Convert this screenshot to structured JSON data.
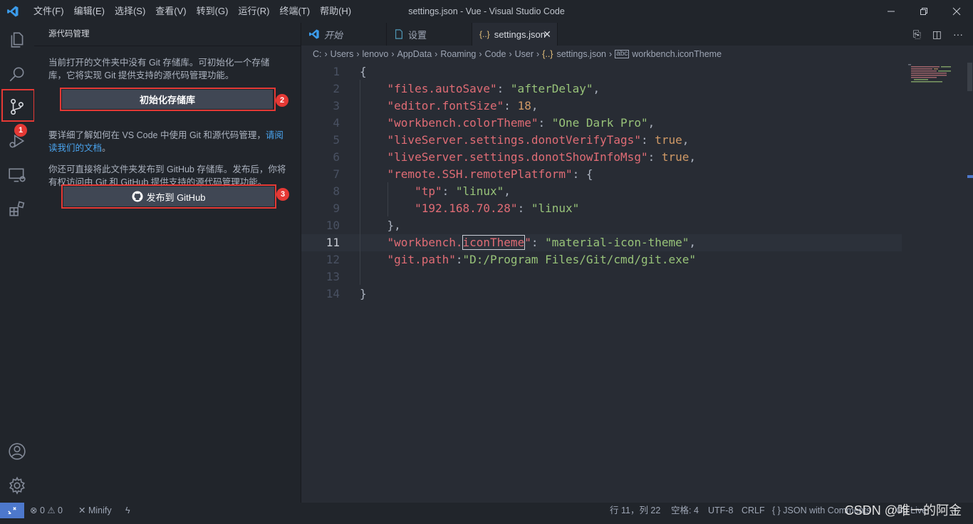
{
  "window": {
    "title": "settings.json - Vue - Visual Studio Code",
    "menu": [
      "文件(F)",
      "编辑(E)",
      "选择(S)",
      "查看(V)",
      "转到(G)",
      "运行(R)",
      "终端(T)",
      "帮助(H)"
    ]
  },
  "activity": {
    "badges": [
      "1",
      "2",
      "3"
    ]
  },
  "sidebar": {
    "header": "源代码管理",
    "intro": "当前打开的文件夹中没有 Git 存储库。可初始化一个存储库，它将实现 Git 提供支持的源代码管理功能。",
    "init_button": "初始化存储库",
    "learn_text": "要详细了解如何在 VS Code 中使用 Git 和源代码管理，",
    "learn_link": "请阅读我们的文档",
    "learn_end": "。",
    "publish_text": "你还可直接将此文件夹发布到 GitHub 存储库。发布后，你将有权访问由 Git 和 GitHub 提供支持的源代码管理功能。",
    "publish_button": "发布到 GitHub"
  },
  "tabs": [
    {
      "label": "开始",
      "icon": "vscode-icon"
    },
    {
      "label": "设置",
      "icon": "file-icon"
    },
    {
      "label": "settings.json",
      "icon": "json-icon",
      "glyph": "{..}",
      "active": true
    }
  ],
  "breadcrumb": [
    "C:",
    "Users",
    "lenovo",
    "AppData",
    "Roaming",
    "Code",
    "User",
    "settings.json",
    "workbench.iconTheme"
  ],
  "editor": {
    "current_line": 11,
    "lines": [
      {
        "n": "1",
        "tokens": [
          [
            "p",
            "{"
          ]
        ]
      },
      {
        "n": "2",
        "tokens": [
          [
            "p",
            "    "
          ],
          [
            "k",
            "\"files.autoSave\""
          ],
          [
            "p",
            ": "
          ],
          [
            "s",
            "\"afterDelay\""
          ],
          [
            "p",
            ","
          ]
        ]
      },
      {
        "n": "3",
        "tokens": [
          [
            "p",
            "    "
          ],
          [
            "k",
            "\"editor.fontSize\""
          ],
          [
            "p",
            ": "
          ],
          [
            "n",
            "18"
          ],
          [
            "p",
            ","
          ]
        ]
      },
      {
        "n": "4",
        "tokens": [
          [
            "p",
            "    "
          ],
          [
            "k",
            "\"workbench.colorTheme\""
          ],
          [
            "p",
            ": "
          ],
          [
            "s",
            "\"One Dark Pro\""
          ],
          [
            "p",
            ","
          ]
        ]
      },
      {
        "n": "5",
        "tokens": [
          [
            "p",
            "    "
          ],
          [
            "k",
            "\"liveServer.settings.donotVerifyTags\""
          ],
          [
            "p",
            ": "
          ],
          [
            "n",
            "true"
          ],
          [
            "p",
            ","
          ]
        ]
      },
      {
        "n": "6",
        "tokens": [
          [
            "p",
            "    "
          ],
          [
            "k",
            "\"liveServer.settings.donotShowInfoMsg\""
          ],
          [
            "p",
            ": "
          ],
          [
            "n",
            "true"
          ],
          [
            "p",
            ","
          ]
        ]
      },
      {
        "n": "7",
        "tokens": [
          [
            "p",
            "    "
          ],
          [
            "k",
            "\"remote.SSH.remotePlatform\""
          ],
          [
            "p",
            ": {"
          ]
        ]
      },
      {
        "n": "8",
        "tokens": [
          [
            "p",
            "        "
          ],
          [
            "k",
            "\"tp\""
          ],
          [
            "p",
            ": "
          ],
          [
            "s",
            "\"linux\""
          ],
          [
            "p",
            ","
          ]
        ]
      },
      {
        "n": "9",
        "tokens": [
          [
            "p",
            "        "
          ],
          [
            "k",
            "\"192.168.70.28\""
          ],
          [
            "p",
            ": "
          ],
          [
            "s",
            "\"linux\""
          ]
        ]
      },
      {
        "n": "10",
        "tokens": [
          [
            "p",
            "    },"
          ]
        ]
      },
      {
        "n": "11",
        "tokens": [
          [
            "p",
            "    "
          ],
          [
            "k",
            "\"workbench."
          ],
          [
            "k hl",
            "iconTheme"
          ],
          [
            "k",
            "\""
          ],
          [
            "p",
            ": "
          ],
          [
            "s",
            "\"material-icon-theme\""
          ],
          [
            "p",
            ","
          ]
        ]
      },
      {
        "n": "12",
        "tokens": [
          [
            "p",
            "    "
          ],
          [
            "k",
            "\"git.path\""
          ],
          [
            "p",
            ":"
          ],
          [
            "s",
            "\"D:/Program Files/Git/cmd/git.exe\""
          ]
        ]
      },
      {
        "n": "13",
        "tokens": []
      },
      {
        "n": "14",
        "tokens": [
          [
            "p",
            "}"
          ]
        ]
      }
    ]
  },
  "status": {
    "remote": "⨯",
    "problems": "⊗ 0 ⚠ 0",
    "minify": "✕ Minify",
    "position": "行 11，列 22",
    "spaces": "空格: 4",
    "encoding": "UTF-8",
    "eol": "CRLF",
    "language": "{ } JSON with Comments",
    "golive": "Go Live"
  },
  "watermark": "CSDN @唯一的阿金",
  "colors": {
    "highlight_box": "#e53935",
    "link": "#4aa5f0",
    "remote_bg": "#4d78cc"
  }
}
